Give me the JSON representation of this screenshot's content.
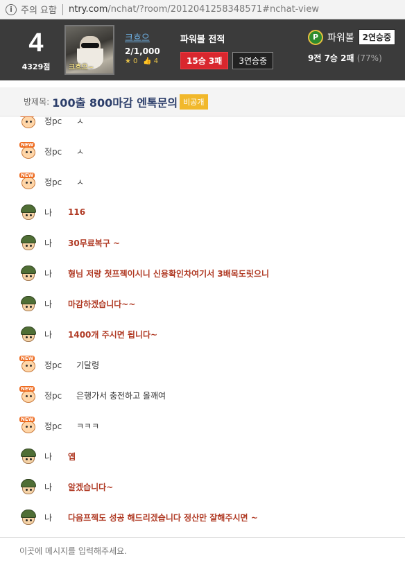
{
  "browser": {
    "warn_icon": "info-icon",
    "warn_text": "주의 요함",
    "url_host": "ntry.com",
    "url_path": "/nchat/?room/2012041258348571#nchat-view"
  },
  "header": {
    "rank": "4",
    "points": "4329점",
    "avatar_nick": "크흐으~",
    "username": "크흐으",
    "record": "2/1,000",
    "stars": "0",
    "likes": "4",
    "game_title": "파워볼 전적",
    "win_loss": "15승 3패",
    "win_streak": "3연승중",
    "powerball_label": "파워볼",
    "powerball_streak": "2연승중",
    "powerball_stat": "9전 7승 2패",
    "powerball_pct": "(77%)"
  },
  "room": {
    "label": "방제목:",
    "title": "100출 800마감 엔톡문의",
    "private": "비공개"
  },
  "messages": [
    {
      "type": "other",
      "name": "정pc",
      "text": "ㅅ"
    },
    {
      "type": "other",
      "name": "정pc",
      "text": "ㅅ"
    },
    {
      "type": "other",
      "name": "정pc",
      "text": "ㅅ"
    },
    {
      "type": "me",
      "name": "나",
      "text": "116"
    },
    {
      "type": "me",
      "name": "나",
      "text": "30무료복구 ~"
    },
    {
      "type": "me",
      "name": "나",
      "text": "형님 저랑 첫프젝이시니 신용확인차여기서 3배목도릿으니"
    },
    {
      "type": "me",
      "name": "나",
      "text": "마감하겠습니다~~"
    },
    {
      "type": "me",
      "name": "나",
      "text": "1400개 주시면 됩니다~"
    },
    {
      "type": "other",
      "name": "정pc",
      "text": "기달령"
    },
    {
      "type": "other",
      "name": "정pc",
      "text": "은행가서 충전하고 올깨여"
    },
    {
      "type": "other",
      "name": "정pc",
      "text": "ㅋㅋㅋ"
    },
    {
      "type": "me",
      "name": "나",
      "text": "옙"
    },
    {
      "type": "me",
      "name": "나",
      "text": "알겠습니다~"
    },
    {
      "type": "me",
      "name": "나",
      "text": "다음프젝도 성공 해드리겠습니다 정산만 잘해주시면 ~"
    }
  ],
  "input": {
    "placeholder": "이곳에 메시지를 입력해주세요."
  },
  "icons": {
    "star": "star-icon",
    "thumb": "thumbs-up-icon",
    "powerball": "powerball-p-icon",
    "other_user": "new-user-icon",
    "me_user": "soldier-user-icon"
  }
}
